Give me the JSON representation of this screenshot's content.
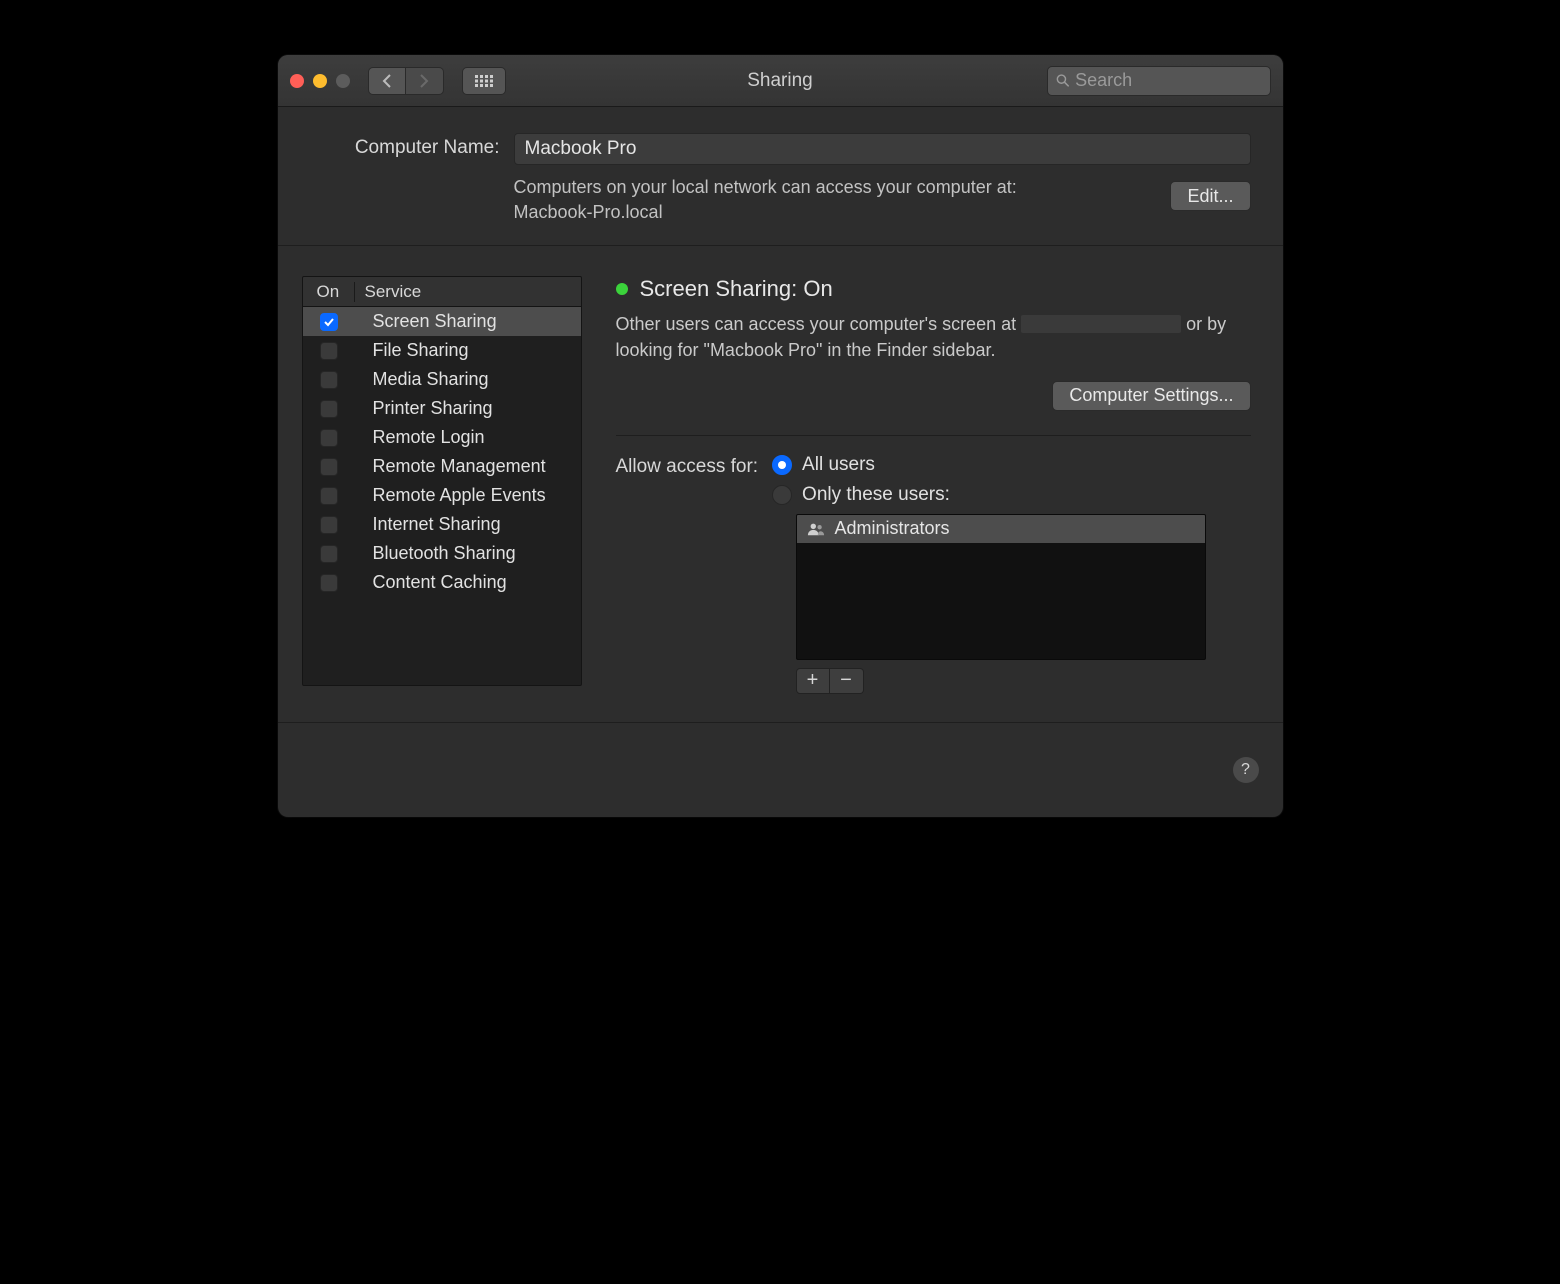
{
  "titlebar": {
    "title": "Sharing",
    "search_placeholder": "Search"
  },
  "computer_name": {
    "label": "Computer Name:",
    "value": "Macbook Pro",
    "subtext_line1": "Computers on your local network can access your computer at:",
    "subtext_line2": "Macbook-Pro.local",
    "edit_button": "Edit..."
  },
  "service_table": {
    "header_on": "On",
    "header_service": "Service",
    "rows": [
      {
        "label": "Screen Sharing",
        "checked": true,
        "selected": true
      },
      {
        "label": "File Sharing",
        "checked": false,
        "selected": false
      },
      {
        "label": "Media Sharing",
        "checked": false,
        "selected": false
      },
      {
        "label": "Printer Sharing",
        "checked": false,
        "selected": false
      },
      {
        "label": "Remote Login",
        "checked": false,
        "selected": false
      },
      {
        "label": "Remote Management",
        "checked": false,
        "selected": false
      },
      {
        "label": "Remote Apple Events",
        "checked": false,
        "selected": false
      },
      {
        "label": "Internet Sharing",
        "checked": false,
        "selected": false
      },
      {
        "label": "Bluetooth Sharing",
        "checked": false,
        "selected": false
      },
      {
        "label": "Content Caching",
        "checked": false,
        "selected": false
      }
    ]
  },
  "detail": {
    "status_title": "Screen Sharing: On",
    "desc_before": "Other users can access your computer's screen at ",
    "desc_after": " or by looking for \"Macbook Pro\" in the Finder sidebar.",
    "computer_settings_button": "Computer Settings...",
    "allow_access_label": "Allow access for:",
    "radio_all": "All users",
    "radio_only": "Only these users:",
    "selected_radio": "all",
    "user_list": [
      "Administrators"
    ],
    "plus": "+",
    "minus": "−"
  },
  "footer": {
    "help": "?"
  }
}
